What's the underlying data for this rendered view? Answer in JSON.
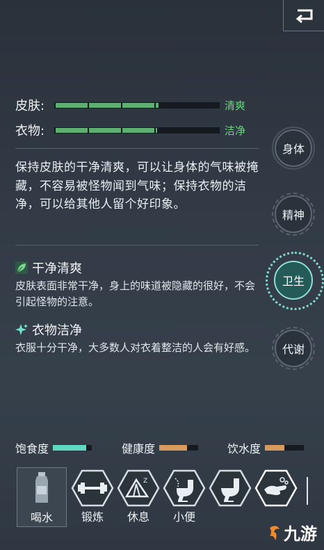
{
  "header": {
    "back_icon": "return-arrow-icon"
  },
  "stats": [
    {
      "label": "皮肤:",
      "value": "清爽",
      "fill": 0.64
    },
    {
      "label": "衣物:",
      "value": "洁净",
      "fill": 0.63
    }
  ],
  "description": "保持皮肤的干净清爽，可以让身体的气味被掩藏，不容易被怪物闻到气味；保持衣物的洁净，可以给其他人留个好印象。",
  "buffs": [
    {
      "icon": "leaf-icon",
      "title": "干净清爽",
      "desc": "皮肤表面非常干净，身上的味道被隐藏的很好，不会引起怪物的注意。"
    },
    {
      "icon": "sparkle-icon",
      "title": "衣物洁净",
      "desc": "衣服十分干净，大多数人对衣着整洁的人会有好感。"
    }
  ],
  "tabs": [
    {
      "label": "身体",
      "active": false
    },
    {
      "label": "精神",
      "active": false
    },
    {
      "label": "卫生",
      "active": true
    },
    {
      "label": "代谢",
      "active": false
    }
  ],
  "gauges": [
    {
      "label": "饱食度",
      "fill": 0.85,
      "color": "#5fd9c2"
    },
    {
      "label": "健康度",
      "fill": 0.72,
      "color": "#d99a5e"
    },
    {
      "label": "饮水度",
      "fill": 0.5,
      "color": "#d99a5e"
    }
  ],
  "actions": [
    {
      "label": "喝水",
      "icon": "water-bottle-icon",
      "selected": true
    },
    {
      "label": "锻炼",
      "icon": "dumbbell-icon",
      "selected": false
    },
    {
      "label": "休息",
      "icon": "tent-icon",
      "selected": false
    },
    {
      "label": "小便",
      "icon": "toilet-icon",
      "selected": false
    },
    {
      "label": "",
      "icon": "toilet-icon",
      "selected": false
    },
    {
      "label": "",
      "icon": "washing-hands-icon",
      "selected": false
    }
  ],
  "watermark": {
    "text": "九游"
  },
  "colors": {
    "accent_green": "#6cd37f",
    "accent_teal": "#8fe0d3",
    "bar_green": "#5fae72"
  }
}
